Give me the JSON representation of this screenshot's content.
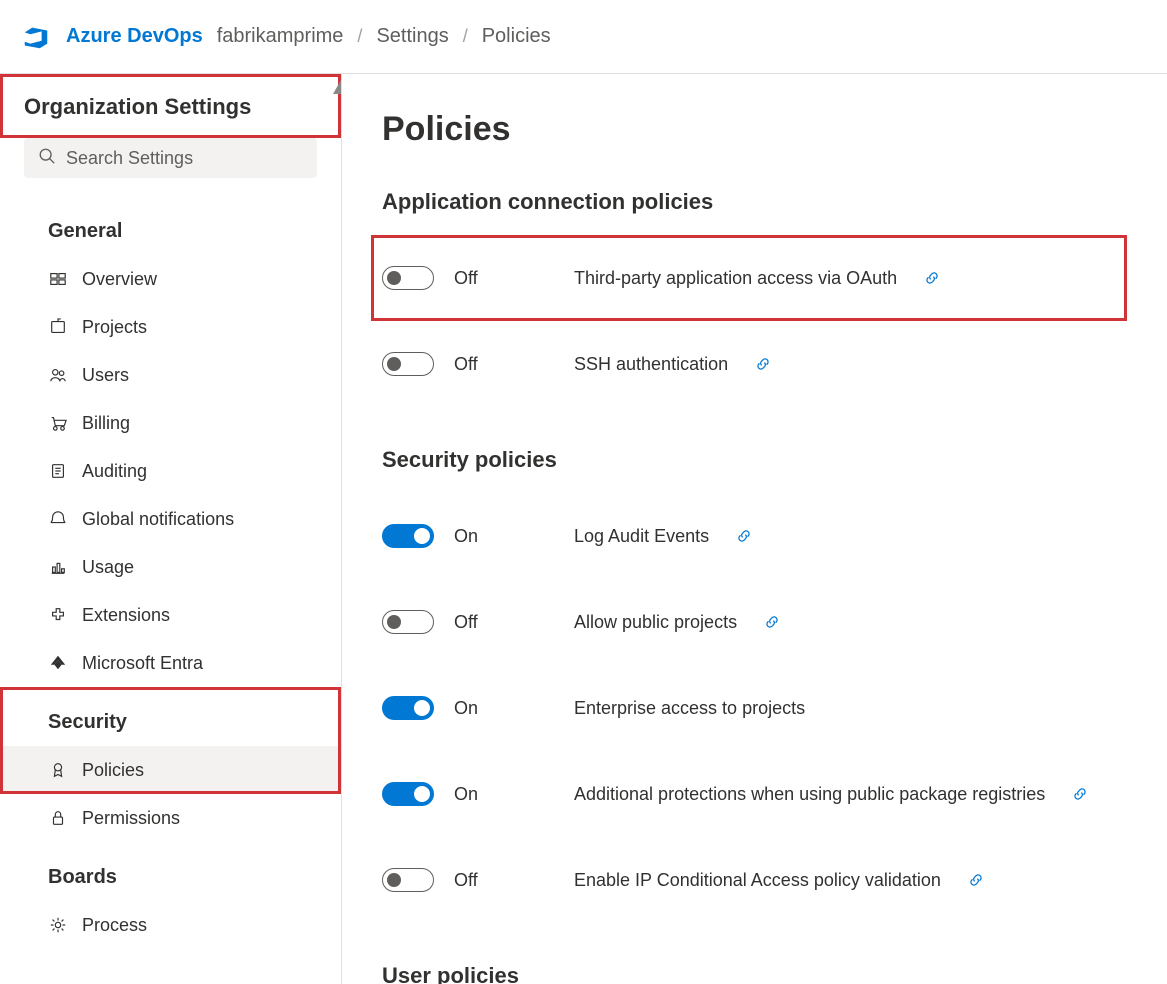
{
  "breadcrumb": {
    "brand": "Azure DevOps",
    "items": [
      "fabrikamprime",
      "Settings",
      "Policies"
    ],
    "sep": "/"
  },
  "sidebar": {
    "title": "Organization Settings",
    "search_placeholder": "Search Settings",
    "groups": [
      {
        "label": "General",
        "items": [
          {
            "icon": "overview",
            "label": "Overview"
          },
          {
            "icon": "projects",
            "label": "Projects"
          },
          {
            "icon": "users",
            "label": "Users"
          },
          {
            "icon": "billing",
            "label": "Billing"
          },
          {
            "icon": "auditing",
            "label": "Auditing"
          },
          {
            "icon": "notifications",
            "label": "Global notifications"
          },
          {
            "icon": "usage",
            "label": "Usage"
          },
          {
            "icon": "extensions",
            "label": "Extensions"
          },
          {
            "icon": "entra",
            "label": "Microsoft Entra"
          }
        ]
      },
      {
        "label": "Security",
        "items": [
          {
            "icon": "policies",
            "label": "Policies",
            "active": true
          },
          {
            "icon": "permissions",
            "label": "Permissions"
          }
        ]
      },
      {
        "label": "Boards",
        "items": [
          {
            "icon": "process",
            "label": "Process"
          }
        ]
      }
    ]
  },
  "content": {
    "title": "Policies",
    "sections": [
      {
        "title": "Application connection policies",
        "policies": [
          {
            "on": false,
            "state": "Off",
            "name": "Third-party application access via OAuth",
            "link": true,
            "highlighted": true
          },
          {
            "on": false,
            "state": "Off",
            "name": "SSH authentication",
            "link": true
          }
        ]
      },
      {
        "title": "Security policies",
        "policies": [
          {
            "on": true,
            "state": "On",
            "name": "Log Audit Events",
            "link": true
          },
          {
            "on": false,
            "state": "Off",
            "name": "Allow public projects",
            "link": true
          },
          {
            "on": true,
            "state": "On",
            "name": "Enterprise access to projects",
            "link": false
          },
          {
            "on": true,
            "state": "On",
            "name": "Additional protections when using public package registries",
            "link": true
          },
          {
            "on": false,
            "state": "Off",
            "name": "Enable IP Conditional Access policy validation",
            "link": true
          }
        ]
      },
      {
        "title": "User policies",
        "policies": []
      }
    ]
  }
}
